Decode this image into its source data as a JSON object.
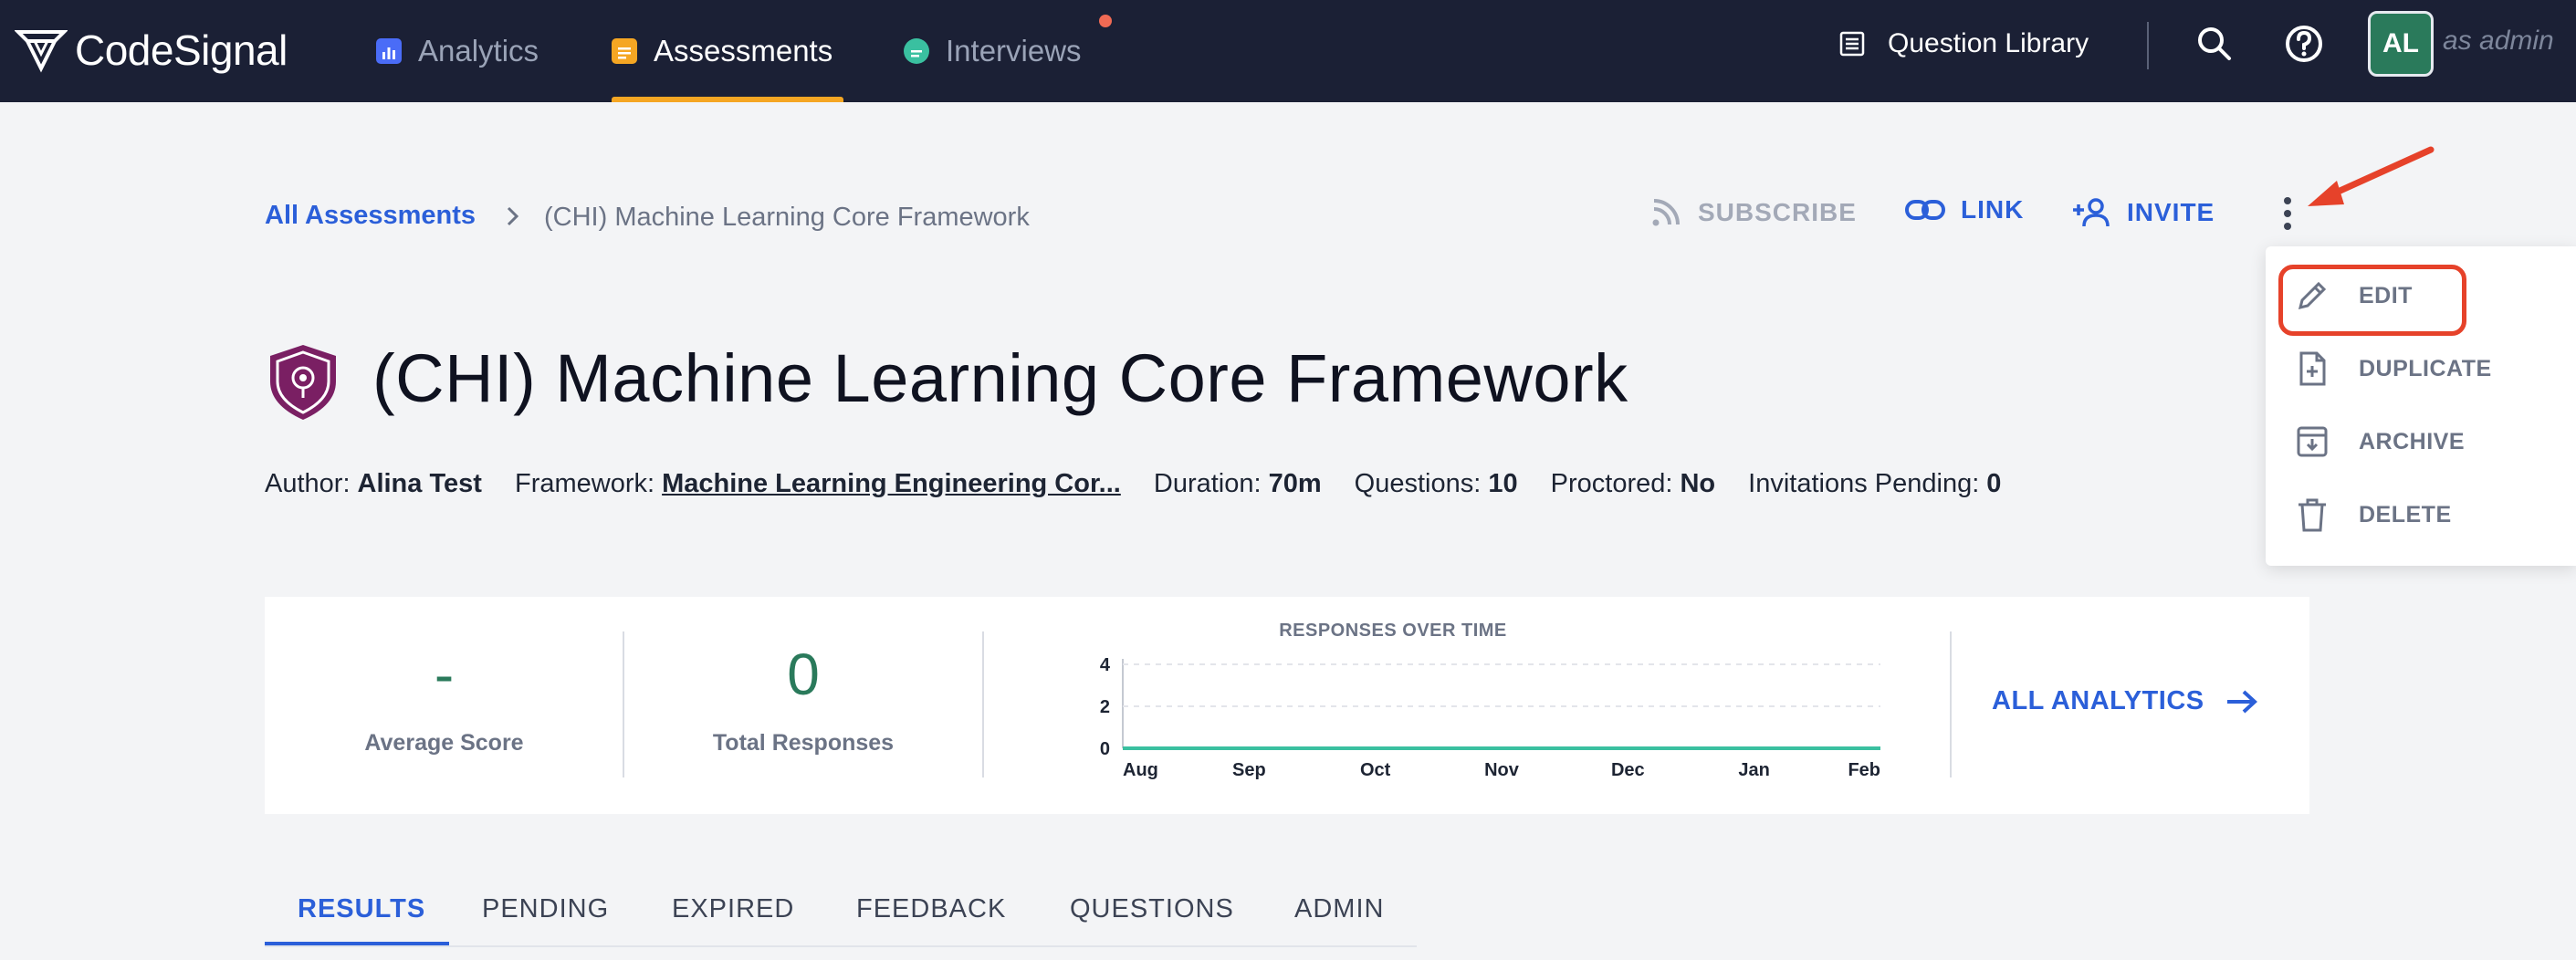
{
  "nav": {
    "brand": "CodeSignal",
    "tabs": [
      {
        "label": "Analytics",
        "icon": "analytics-icon",
        "color": "#4a6cf7"
      },
      {
        "label": "Assessments",
        "icon": "assessments-icon",
        "color": "#f5a623"
      },
      {
        "label": "Interviews",
        "icon": "interviews-icon",
        "color": "#3ac0a0"
      }
    ],
    "question_library": "Question Library",
    "avatar_initials": "AL",
    "role_text": "as admin"
  },
  "breadcrumb": {
    "parent": "All Assessments",
    "separator": ">",
    "current": "(CHI) Machine Learning Core Framework"
  },
  "actions": {
    "subscribe": "SUBSCRIBE",
    "link": "LINK",
    "invite": "INVITE"
  },
  "menu": {
    "items": [
      "EDIT",
      "DUPLICATE",
      "ARCHIVE",
      "DELETE"
    ]
  },
  "assessment": {
    "title": "(CHI) Machine Learning Core Framework",
    "author_label": "Author:",
    "author": "Alina Test",
    "framework_label": "Framework:",
    "framework": "Machine Learning Engineering Cor...",
    "duration_label": "Duration:",
    "duration": "70m",
    "questions_label": "Questions:",
    "questions": "10",
    "proctored_label": "Proctored:",
    "proctored": "No",
    "invitations_label": "Invitations Pending:",
    "invitations": "0"
  },
  "stats": {
    "average_score": "-",
    "average_score_label": "Average Score",
    "total_responses": "0",
    "total_responses_label": "Total Responses",
    "all_analytics": "ALL ANALYTICS"
  },
  "chart_data": {
    "type": "line",
    "title": "RESPONSES OVER TIME",
    "x": [
      "Aug",
      "Sep",
      "Oct",
      "Nov",
      "Dec",
      "Jan",
      "Feb"
    ],
    "series": [
      {
        "values": [
          0,
          0,
          0,
          0,
          0,
          0,
          0
        ]
      }
    ],
    "yticks": [
      "0",
      "2",
      "4"
    ],
    "ylim": [
      0,
      4
    ],
    "grid": true,
    "line_color": "#3ac0a0"
  },
  "tabs": [
    "RESULTS",
    "PENDING",
    "EXPIRED",
    "FEEDBACK",
    "QUESTIONS",
    "ADMIN"
  ]
}
